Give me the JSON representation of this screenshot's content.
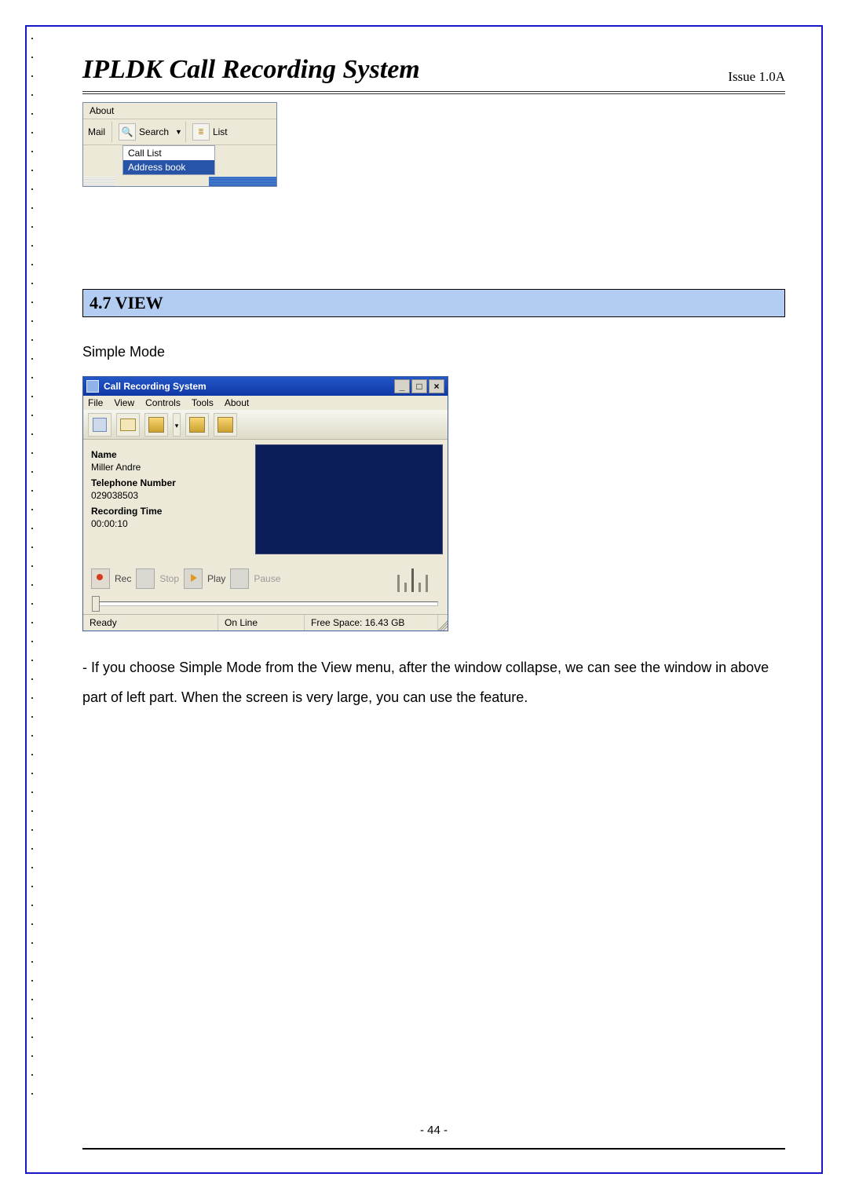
{
  "header": {
    "title": "IPLDK Call Recording System",
    "issue": "Issue 1.0A"
  },
  "shot1": {
    "menu_about": "About",
    "mail_fragment": "Mail",
    "search_label": "Search",
    "list_label": "List",
    "dropdown": {
      "item_calllist": "Call List",
      "item_addressbook": "Address book"
    }
  },
  "section": {
    "heading": "4.7 VIEW",
    "subtext": "Simple Mode"
  },
  "shot2": {
    "title": "Call Recording System",
    "menu": {
      "file": "File",
      "view": "View",
      "controls": "Controls",
      "tools": "Tools",
      "about": "About"
    },
    "fields": {
      "name_label": "Name",
      "name_value": "Miller Andre",
      "tel_label": "Telephone Number",
      "tel_value": "029038503",
      "rectime_label": "Recording Time",
      "rectime_value": "00:00:10"
    },
    "controls": {
      "rec": "Rec",
      "stop": "Stop",
      "play": "Play",
      "pause": "Pause"
    },
    "status": {
      "ready": "Ready",
      "online": "On Line",
      "freespace": "Free Space: 16.43 GB"
    }
  },
  "paragraph": "- If you choose Simple Mode from the View menu, after the window collapse, we can see the window in above part of left part. When the screen is very large, you can use the feature.",
  "page_number": "- 44 -"
}
